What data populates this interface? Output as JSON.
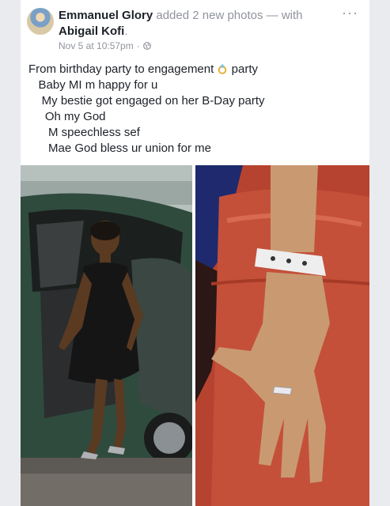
{
  "post": {
    "author": "Emmanuel Glory",
    "action": " added 2 new photos — with ",
    "tagged": "Abigail Kofi",
    "tagged_suffix": ".",
    "timestamp": "Nov 5 at 10:57pm",
    "separator": "·",
    "privacy_icon": "globe-icon",
    "more_icon": "more-options-icon"
  },
  "text": {
    "line1_a": "From birthday party to engagement ",
    "line1_b": " party",
    "line2": "   Baby MI m happy for u",
    "line3": "    My bestie got engaged on her B-Day party",
    "line4": "     Oh my God",
    "line5": "      M speechless sef",
    "line6": "      Mae God bless ur union for me",
    "ring_icon": "ring-icon"
  },
  "photos": [
    {
      "name": "Woman in black dress stepping out of a green car"
    },
    {
      "name": "Hand with engagement ring and white bracelet"
    }
  ]
}
